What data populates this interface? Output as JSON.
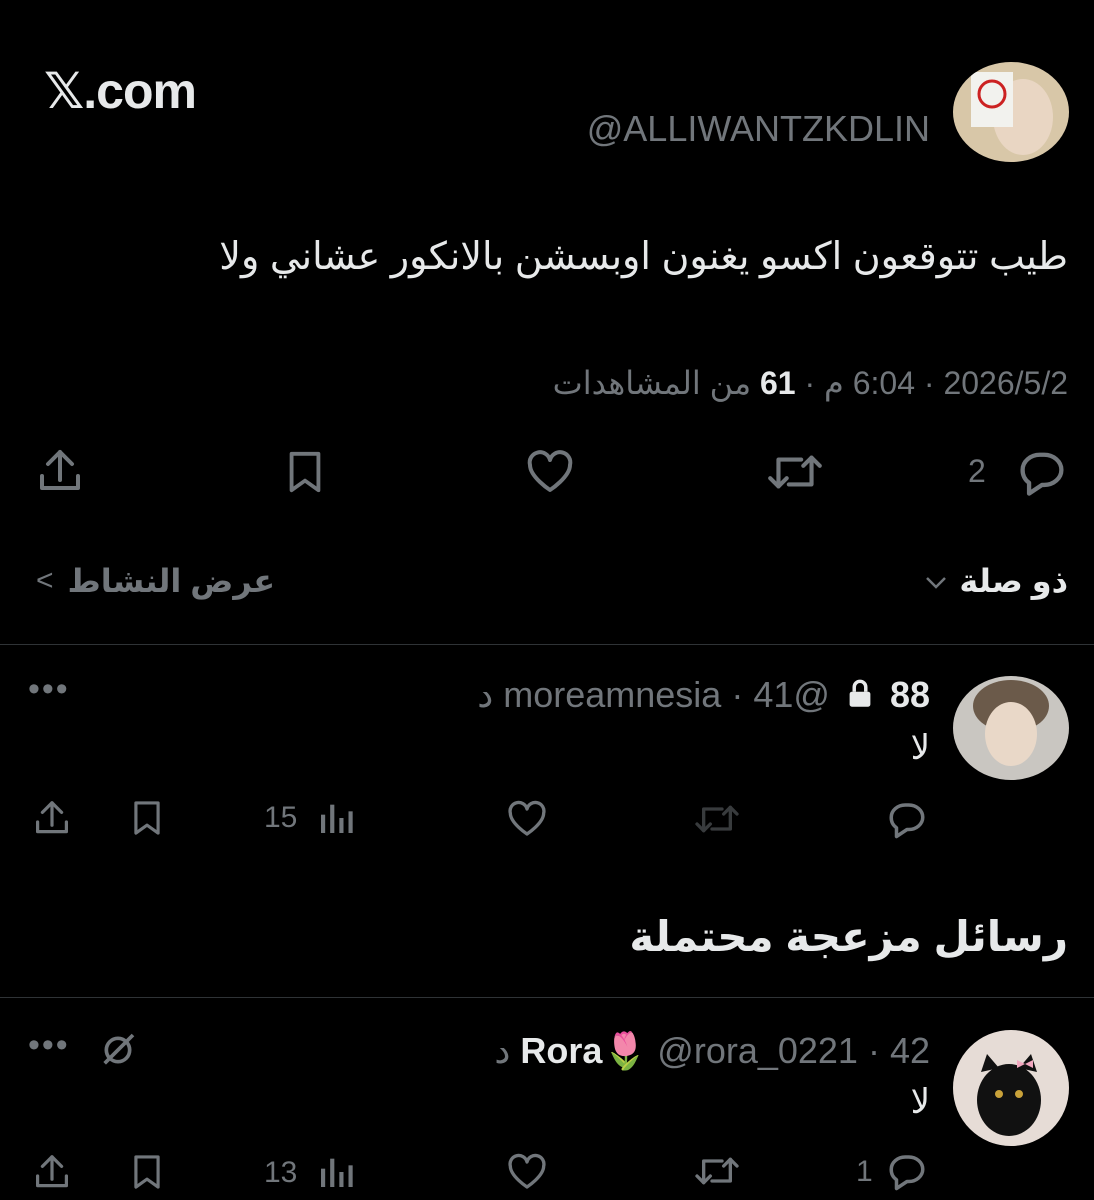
{
  "brand": {
    "logo_text": "𝕏.com"
  },
  "main_tweet": {
    "handle": "@ALLIWANTZKDLIN",
    "text": "طيب تتوقعون اكسو يغنون اوبسشن بالانكور عشاني ولا",
    "date": "2026/5/2 · 6:04 م · ",
    "views_count": "61",
    "views_label": " من المشاهدات",
    "reply_count": "2",
    "sort_label": "ذو صلة",
    "activity_label": "عرض النشاط"
  },
  "replies": [
    {
      "name": "88",
      "handle": "@moreamnesia · 41 د",
      "text": "لا",
      "views": "15",
      "locked": true
    }
  ],
  "spam_section": {
    "title": "رسائل مزعجة محتملة",
    "reply": {
      "name": "Rora🌷",
      "handle": "@rora_0221 · 42 د",
      "text": "لا",
      "views": "13",
      "reply_count": "1"
    }
  },
  "colors": {
    "background": "#000000",
    "text": "#e7e9ea",
    "muted": "#71767b",
    "divider": "#2f3336"
  }
}
